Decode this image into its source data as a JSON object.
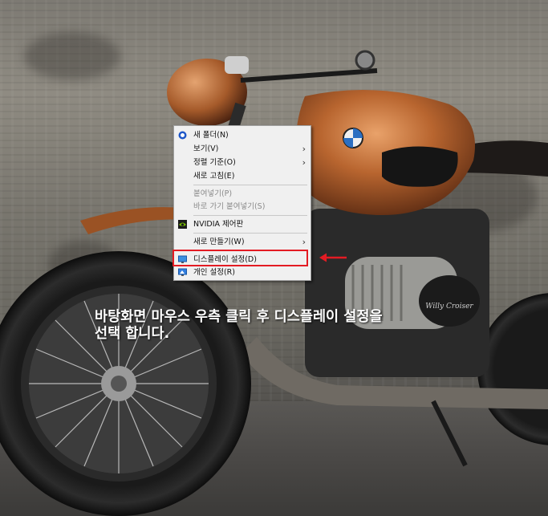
{
  "context_menu": {
    "items": [
      {
        "label": "새 폴더(N)",
        "icon": "new-folder-icon"
      },
      {
        "label": "보기(V)",
        "submenu": true
      },
      {
        "label": "정렬 기준(O)",
        "submenu": true
      },
      {
        "label": "새로 고침(E)"
      },
      {
        "label": "붙여넣기(P)",
        "disabled": true
      },
      {
        "label": "바로 가기 붙여넣기(S)",
        "disabled": true
      },
      {
        "label": "NVIDIA 제어판",
        "icon": "nvidia-icon"
      },
      {
        "label": "새로 만들기(W)",
        "submenu": true
      },
      {
        "label": "디스플레이 설정(D)",
        "icon": "display-icon",
        "highlighted": true
      },
      {
        "label": "개인 설정(R)",
        "icon": "personalize-icon"
      }
    ]
  },
  "annotation": {
    "highlight_color": "#e31b23",
    "arrow_color": "#e31b23"
  },
  "caption": {
    "line1": "바탕화면 마우스 우측 클릭 후 디스플레이 설정을",
    "line2": "선택 합니다."
  },
  "wallpaper": {
    "logo_text": "Willy Croiser"
  }
}
